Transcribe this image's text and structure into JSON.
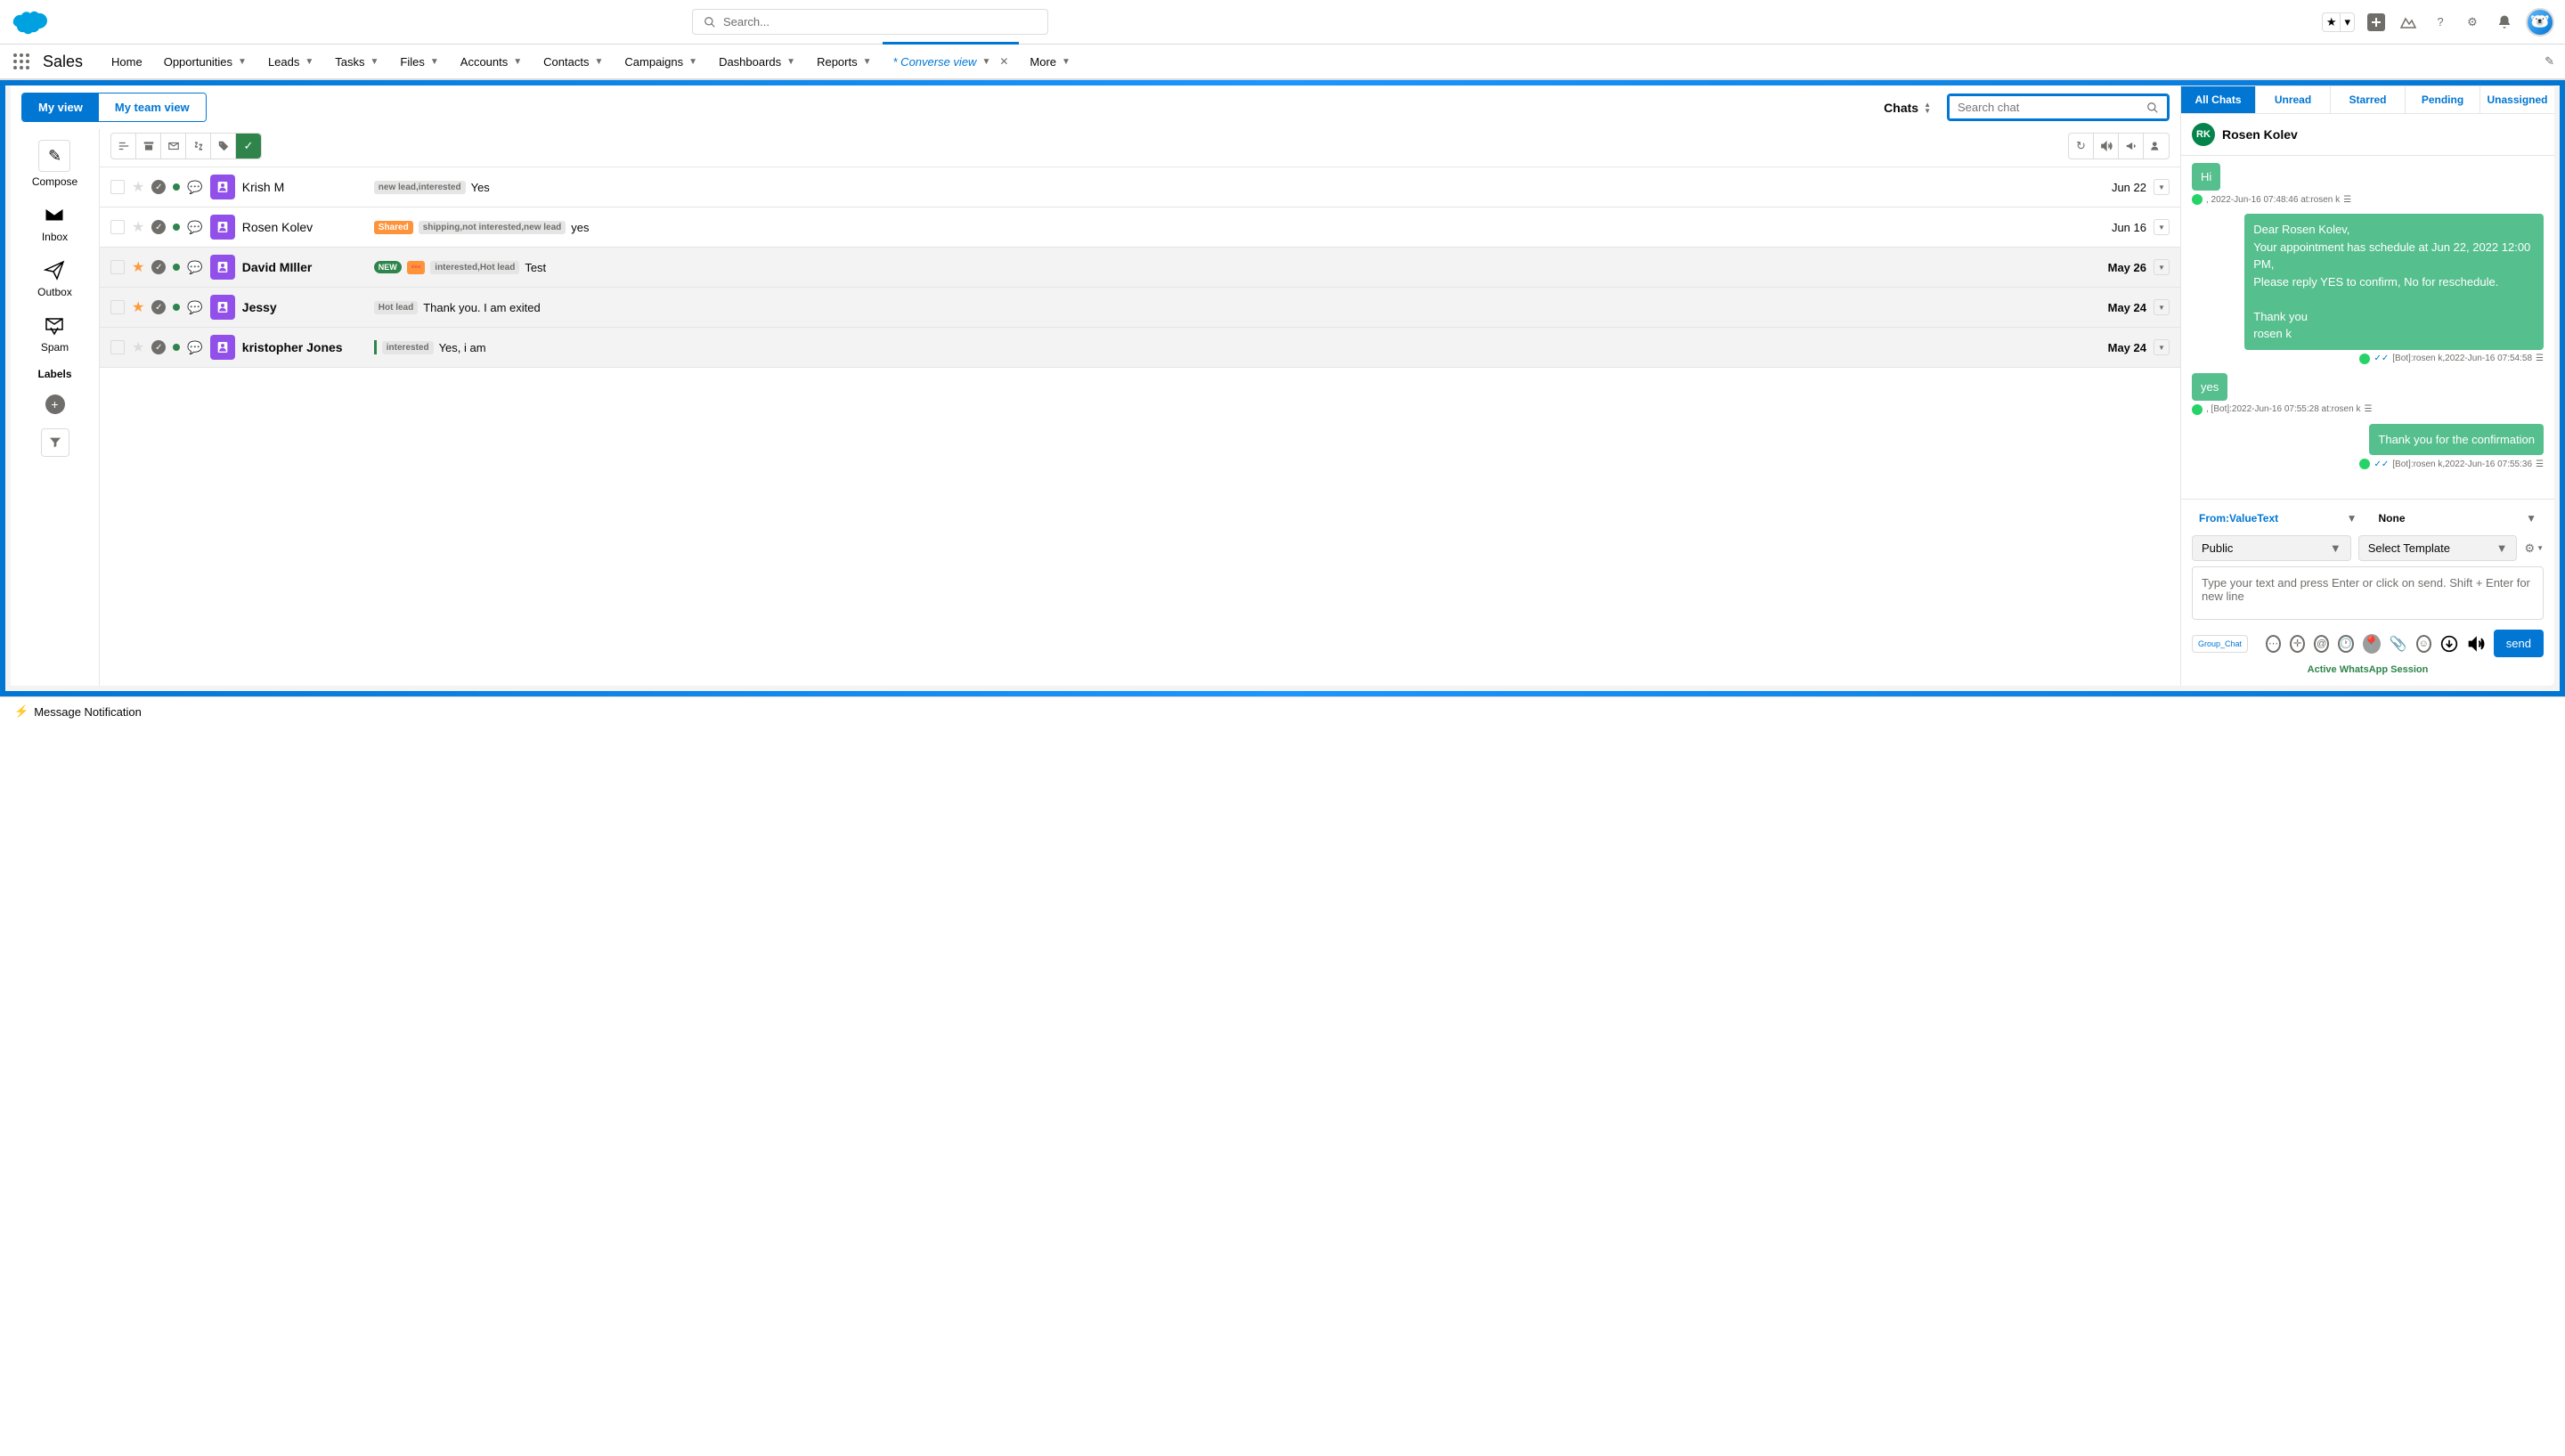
{
  "header": {
    "search_placeholder": "Search..."
  },
  "nav": {
    "app_name": "Sales",
    "items": [
      "Home",
      "Opportunities",
      "Leads",
      "Tasks",
      "Files",
      "Accounts",
      "Contacts",
      "Campaigns",
      "Dashboards",
      "Reports"
    ],
    "active_tab": "* Converse view",
    "more": "More"
  },
  "views": {
    "my_view": "My view",
    "team_view": "My team view",
    "chats_dd": "Chats",
    "search_chat_placeholder": "Search chat"
  },
  "rail": {
    "compose": "Compose",
    "inbox": "Inbox",
    "outbox": "Outbox",
    "spam": "Spam",
    "labels": "Labels"
  },
  "rows": [
    {
      "name": "Krish M",
      "tags": [
        "new lead,interested"
      ],
      "preview": "Yes",
      "date": "Jun 22",
      "starred": false,
      "unread": false,
      "badges": []
    },
    {
      "name": "Rosen Kolev",
      "tags": [
        "shipping,not interested,new lead"
      ],
      "preview": "yes",
      "date": "Jun 16",
      "starred": false,
      "unread": false,
      "badges": [
        "Shared"
      ]
    },
    {
      "name": "David MIller",
      "tags": [
        "interested,Hot lead"
      ],
      "preview": "Test",
      "date": "May 26",
      "starred": true,
      "unread": true,
      "badges": [
        "NEW",
        "..."
      ]
    },
    {
      "name": "Jessy",
      "tags": [
        "Hot lead"
      ],
      "preview": "Thank you. I am exited",
      "date": "May 24",
      "starred": true,
      "unread": true,
      "badges": []
    },
    {
      "name": "kristopher Jones",
      "tags": [
        "interested"
      ],
      "preview": "Yes, i am",
      "date": "May 24",
      "starred": false,
      "unread": true,
      "badges": [
        "|"
      ]
    }
  ],
  "filter_tabs": [
    "All Chats",
    "Unread",
    "Starred",
    "Pending",
    "Unassigned"
  ],
  "chat": {
    "contact_initials": "RK",
    "contact_name": "Rosen Kolev",
    "messages": [
      {
        "dir": "in",
        "text": "Hi",
        "meta": ", 2022-Jun-16 07:48:46 at:rosen k"
      },
      {
        "dir": "out",
        "text": "Dear Rosen Kolev,\nYour appointment has schedule at Jun 22, 2022 12:00 PM,\nPlease reply YES to confirm, No for reschedule.\n\nThank you\nrosen k",
        "meta": "[Bot]:rosen k,2022-Jun-16 07:54:58"
      },
      {
        "dir": "in",
        "text": "yes",
        "meta": ", [Bot]:2022-Jun-16 07:55:28 at:rosen k"
      },
      {
        "dir": "out",
        "text": "Thank you for the confirmation",
        "meta": "[Bot]:rosen k,2022-Jun-16 07:55:36"
      }
    ],
    "from_label": "From:ValueText",
    "none_label": "None",
    "public_label": "Public",
    "template_label": "Select Template",
    "input_placeholder": "Type your text and press Enter or click on send. Shift + Enter for new line",
    "group_chat": "Group_Chat",
    "send": "send",
    "session": "Active WhatsApp Session"
  },
  "footer": {
    "notification": "Message Notification"
  }
}
